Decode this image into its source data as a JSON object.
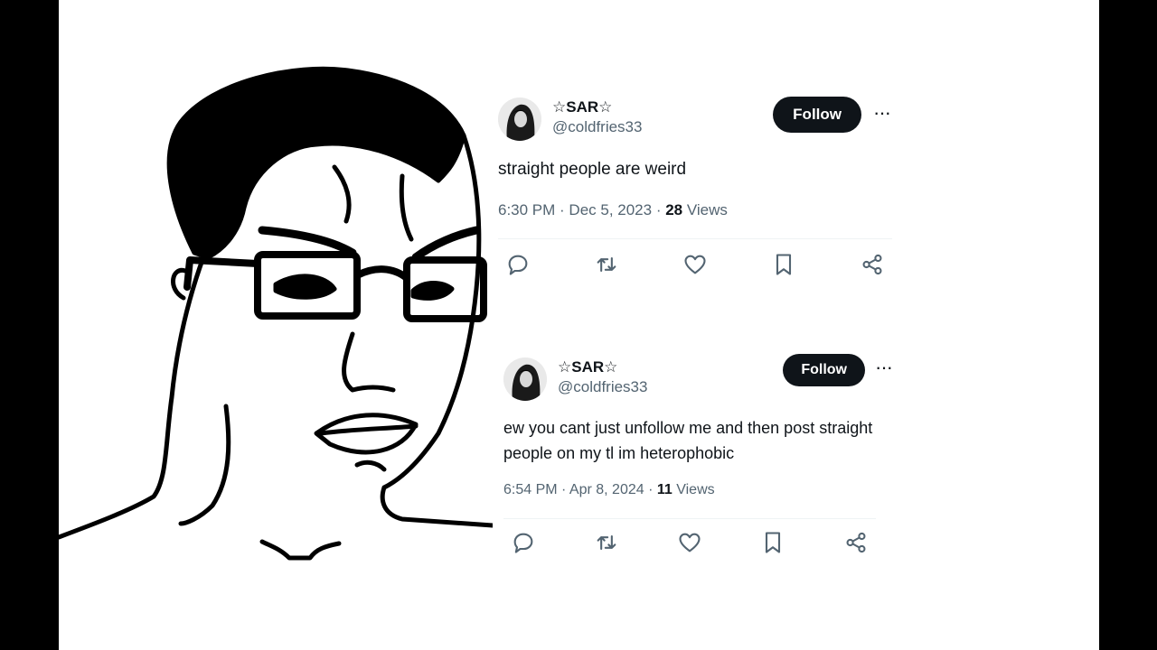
{
  "tweets": [
    {
      "display_name": "☆SAR☆",
      "handle": "@coldfries33",
      "follow_label": "Follow",
      "more_label": "···",
      "text": "straight people are weird",
      "time_date": "6:30 PM · Dec 5, 2023 · ",
      "views_count": "28",
      "views_label": " Views"
    },
    {
      "display_name": "☆SAR☆",
      "handle": "@coldfries33",
      "follow_label": "Follow",
      "more_label": "···",
      "text": "ew you cant just unfollow me and then post straight people on my tl im heterophobic",
      "time_date": "6:54 PM · Apr 8, 2024 · ",
      "views_count": "11",
      "views_label": " Views"
    }
  ],
  "icons": [
    "reply-icon",
    "retweet-icon",
    "like-icon",
    "bookmark-icon",
    "share-icon"
  ],
  "colors": {
    "text_primary": "#0f1419",
    "text_secondary": "#536471",
    "button_bg": "#0f1419",
    "divider": "#eff3f4",
    "letterbox": "#000000"
  }
}
